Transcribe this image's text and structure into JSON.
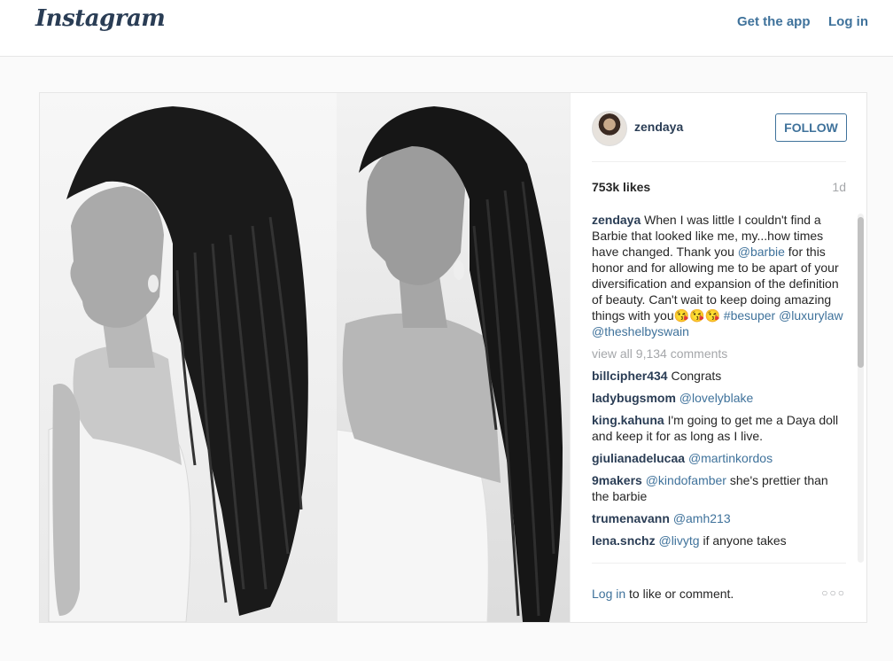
{
  "topbar": {
    "logo": "Instagram",
    "get_app": "Get the app",
    "login": "Log in"
  },
  "post": {
    "author": "zendaya",
    "follow_label": "FOLLOW",
    "likes": "753k likes",
    "time": "1d",
    "caption": {
      "user": "zendaya",
      "text1": "When I was little I couldn't find a Barbie that looked like me, my...how times have changed. Thank you ",
      "mention1": "@barbie",
      "text2": " for this honor and for allowing me to be apart of your diversification and expansion of the definition of beauty. Can't wait to keep doing amazing things with you",
      "emojis": "😘😘😘",
      "hashtag": "#besuper",
      "mention2": "@luxurylaw",
      "mention3": "@theshelbyswain"
    },
    "view_all": "view all 9,134 comments",
    "comments": [
      {
        "user": "billcipher434",
        "text": "Congrats",
        "mention": ""
      },
      {
        "user": "ladybugsmom",
        "text": "",
        "mention": "@lovelyblake"
      },
      {
        "user": "king.kahuna",
        "text": "I'm going to get me a Daya doll and keep it for as long as I live.",
        "mention": ""
      },
      {
        "user": "giulianadelucaa",
        "text": "",
        "mention": "@martinkordos"
      },
      {
        "user": "9makers",
        "text": "she's prettier than the barbie",
        "mention": "@kindofamber"
      },
      {
        "user": "trumenavann",
        "text": "",
        "mention": "@amh213"
      },
      {
        "user": "lena.snchz",
        "text": "if anyone takes",
        "mention": "@livytg"
      }
    ],
    "footer": {
      "login_link": "Log in",
      "login_text": " to like or comment.",
      "more": "○○○"
    }
  },
  "colors": {
    "link": "#3f729b",
    "username": "#2a3d55",
    "muted": "#a5a7aa",
    "background": "#fafafa"
  }
}
